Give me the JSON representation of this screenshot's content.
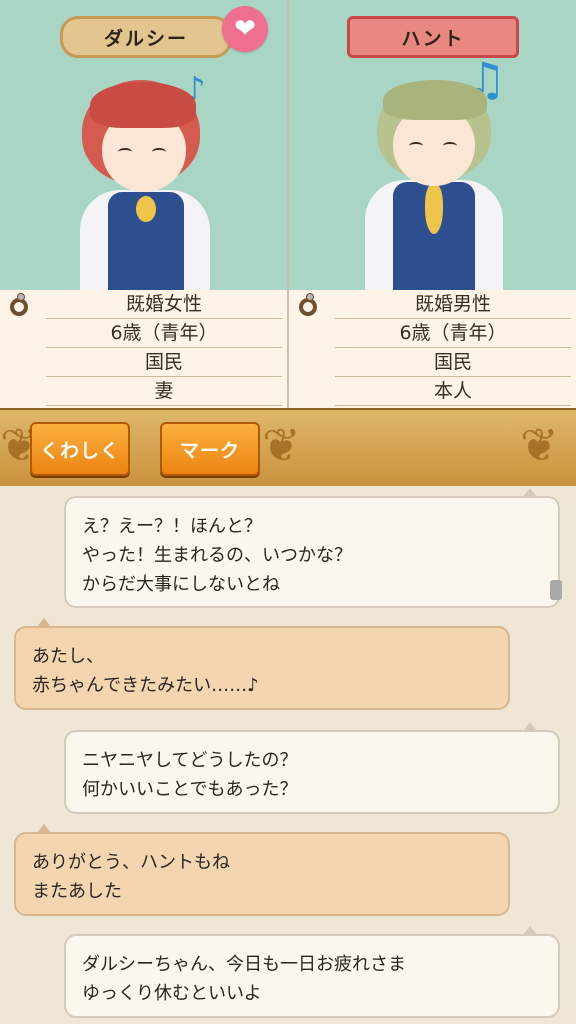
{
  "characters": {
    "left": {
      "name": "ダルシー",
      "status": "既婚女性",
      "age": "6歳（青年）",
      "citizenship": "国民",
      "relation": "妻"
    },
    "right": {
      "name": "ハント",
      "status": "既婚男性",
      "age": "6歳（青年）",
      "citizenship": "国民",
      "relation": "本人"
    }
  },
  "icons": {
    "heart": "heart-icon",
    "note": "music-note-icon",
    "ring": "ring-icon"
  },
  "toolbar": {
    "detail_label": "くわしく",
    "mark_label": "マーク"
  },
  "messages": [
    {
      "side": "right",
      "text": "え？えー？！ほんと？\nやった！生まれるの、いつかな？\nからだ大事にしないとね"
    },
    {
      "side": "left",
      "text": "あたし、\n赤ちゃんできたみたい……♪"
    },
    {
      "side": "right",
      "text": "ニヤニヤしてどうしたの？\n何かいいことでもあった？"
    },
    {
      "side": "left",
      "text": "ありがとう、ハントもね\nまたあした"
    },
    {
      "side": "right",
      "text": "ダルシーちゃん、今日も一日お疲れさま\nゆっくり休むといいよ"
    }
  ],
  "colors": {
    "panel_bg": "#a9d6c4",
    "left_name_bg": "#e3c58f",
    "right_name_bg": "#e98783",
    "button_orange": "#ec8413",
    "bar_gold": "#c9923d"
  }
}
